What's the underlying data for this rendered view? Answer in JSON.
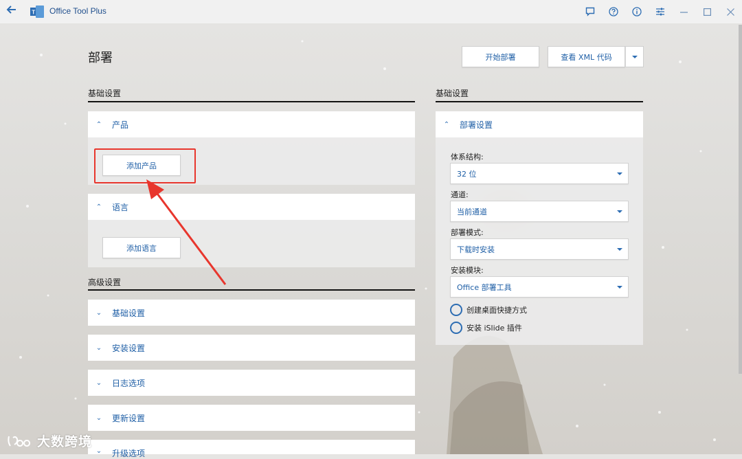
{
  "app": {
    "title": "Office Tool Plus"
  },
  "titlebar": {
    "icons": [
      "feedback-icon",
      "help-icon",
      "info-icon",
      "settings-icon"
    ],
    "window_controls": [
      "minimize-icon",
      "maximize-icon",
      "close-icon"
    ]
  },
  "page": {
    "title": "部署"
  },
  "toolbar": {
    "start_label": "开始部署",
    "view_xml_label": "查看 XML 代码"
  },
  "left": {
    "basic_heading": "基础设置",
    "product": {
      "header": "产品",
      "add_label": "添加产品"
    },
    "language": {
      "header": "语言",
      "add_label": "添加语言"
    },
    "advanced_heading": "高级设置",
    "advanced_items": [
      {
        "label": "基础设置"
      },
      {
        "label": "安装设置"
      },
      {
        "label": "日志选项"
      },
      {
        "label": "更新设置"
      },
      {
        "label": "升级选项"
      }
    ]
  },
  "right": {
    "heading": "基础设置",
    "panel_header": "部署设置",
    "fields": [
      {
        "label": "体系结构:",
        "value": "32 位"
      },
      {
        "label": "通道:",
        "value": "当前通道"
      },
      {
        "label": "部署模式:",
        "value": "下载时安装"
      },
      {
        "label": "安装模块:",
        "value": "Office 部署工具"
      }
    ],
    "options": [
      {
        "label": "创建桌面快捷方式"
      },
      {
        "label": "安装 iSlide 插件"
      }
    ]
  },
  "watermark": {
    "text": "大数跨境"
  },
  "colors": {
    "accent": "#2d6db3",
    "highlight": "#e8362d",
    "link": "#1f5fa6"
  }
}
